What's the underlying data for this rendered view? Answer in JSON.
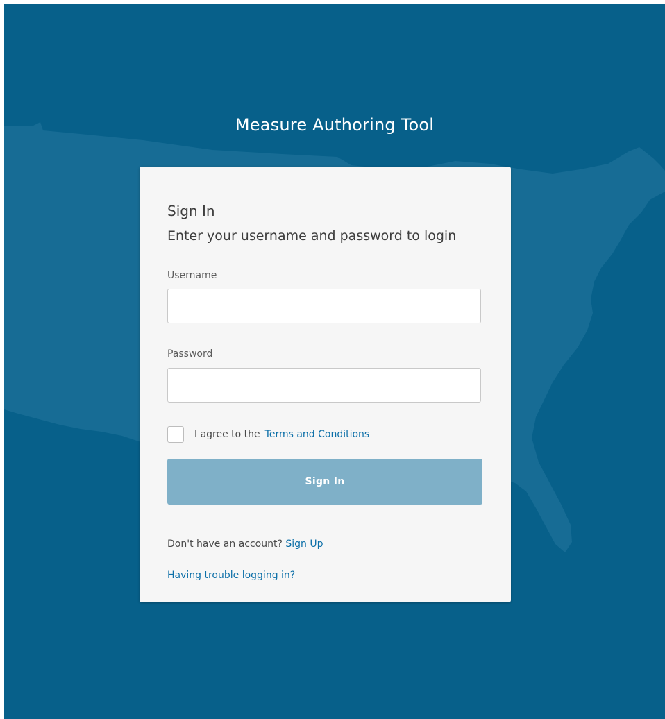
{
  "app": {
    "title": "Measure Authoring Tool"
  },
  "login_card": {
    "heading": "Sign In",
    "subheading": "Enter your username and password to login",
    "username": {
      "label": "Username",
      "value": "",
      "placeholder": ""
    },
    "password": {
      "label": "Password",
      "value": "",
      "placeholder": ""
    },
    "terms": {
      "checked": false,
      "prefix": "I agree to the",
      "link_label": "Terms and Conditions"
    },
    "sign_in_button_label": "Sign In",
    "signup": {
      "prompt": "Don't have an account?",
      "link_label": "Sign Up"
    },
    "trouble_link_label": "Having trouble logging in?"
  },
  "colors": {
    "background": "#07608a",
    "map_shape": "#1a6f96",
    "card": "#f6f6f6",
    "link": "#0c6fa8",
    "button_disabled": "#7fb0c8"
  }
}
